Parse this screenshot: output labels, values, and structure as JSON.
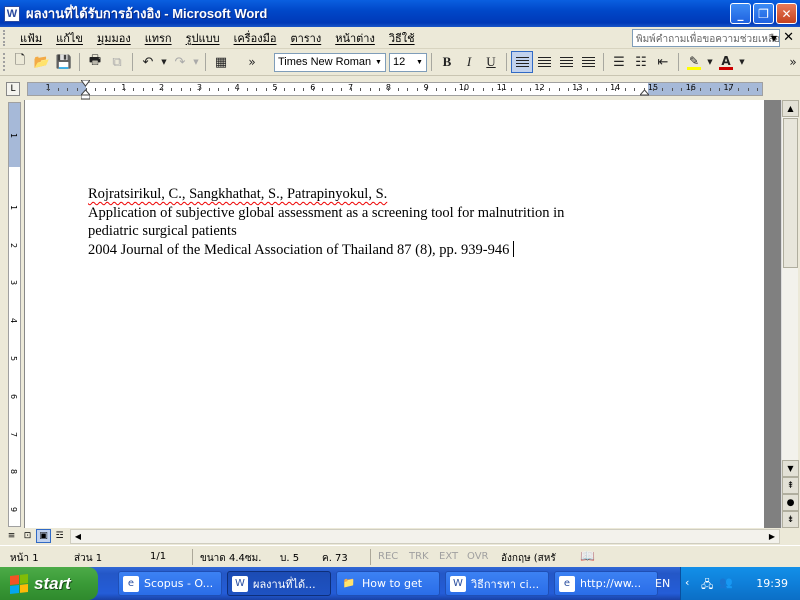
{
  "window": {
    "app_icon": "W",
    "title": "ผลงานที่ได้รับการอ้างอิง - Microsoft Word",
    "controls": {
      "minimize": "_",
      "restore": "❐",
      "close": "✕"
    }
  },
  "menu": {
    "items": [
      "แฟ้ม",
      "แก้ไข",
      "มุมมอง",
      "แทรก",
      "รูปแบบ",
      "เครื่องมือ",
      "ตาราง",
      "หน้าต่าง",
      "วิธีใช้"
    ],
    "help_placeholder": "พิมพ์คำถามเพื่อขอความช่วยเหลือ",
    "close": "✕"
  },
  "toolbar": {
    "font_name": "Times New Roman",
    "font_size": "12",
    "bold": "B",
    "italic": "I",
    "underline": "U",
    "font_color": "#cc0000",
    "highlight_color": "#ffff00",
    "highlight_label": "✎",
    "font_color_label": "A"
  },
  "ruler": {
    "corner": "L",
    "labels": [
      "1",
      "1",
      "2",
      "3",
      "4",
      "5",
      "6",
      "7",
      "8",
      "9",
      "10",
      "11",
      "12",
      "13",
      "14",
      "15",
      "16",
      "17"
    ],
    "vlabels": [
      "1",
      "1",
      "2",
      "3",
      "4",
      "5",
      "6",
      "7",
      "8",
      "9"
    ]
  },
  "document": {
    "lines": [
      "Rojratsirikul, C., Sangkhathat, S., Patrapinyokul, S.",
      "Application of subjective global assessment as a screening tool for malnutrition in",
      "pediatric surgical patients",
      "2004 Journal of the Medical Association of Thailand 87 (8), pp. 939-946"
    ]
  },
  "status": {
    "page": "หน้า 1",
    "section": "ส่วน 1",
    "page_of": "1/1",
    "position": "ขนาด 4.4ซม.",
    "line": "บ. 5",
    "column": "ค. 73",
    "rec": "REC",
    "trk": "TRK",
    "ext": "EXT",
    "ovr": "OVR",
    "language": "อังกฤษ (สหรั"
  },
  "taskbar": {
    "start_label": "start",
    "tasks": [
      {
        "label": "Scopus - O...",
        "icon": "e",
        "active": false
      },
      {
        "label": "ผลงานที่ได้...",
        "icon": "W",
        "active": true
      },
      {
        "label": "How to get",
        "icon": "📁",
        "active": false
      },
      {
        "label": "วิธีการหา ci...",
        "icon": "W",
        "active": false
      },
      {
        "label": "http://ww...",
        "icon": "e",
        "active": false
      }
    ],
    "language": "EN",
    "clock": "19:39"
  }
}
